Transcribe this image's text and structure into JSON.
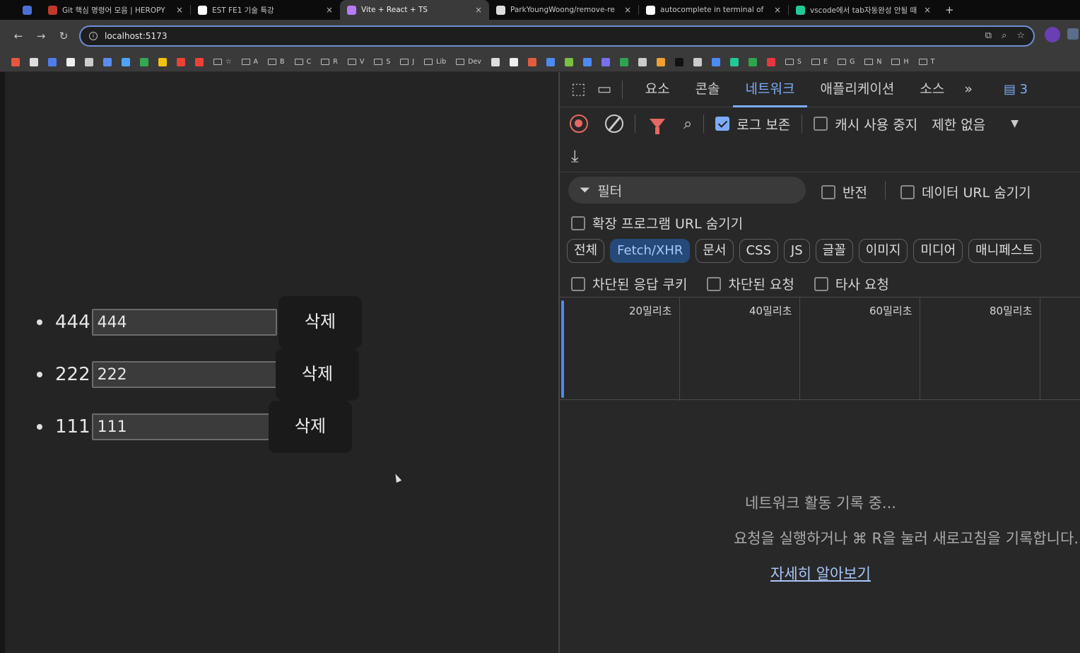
{
  "browser": {
    "tabs": [
      {
        "label": "",
        "color": "#4c6fd6",
        "active": false
      },
      {
        "label": "Git 핵심 명령어 모음 | HEROPY",
        "color": "#c0392b",
        "active": false
      },
      {
        "label": "EST FE1 기술 특강",
        "color": "#ffffff",
        "active": false
      },
      {
        "label": "Vite + React + TS",
        "color": "#b77cf5",
        "active": true
      },
      {
        "label": "ParkYoungWoong/remove-re",
        "color": "#dddddd",
        "active": false
      },
      {
        "label": "autocomplete in terminal of",
        "color": "#ffffff",
        "active": false
      },
      {
        "label": "vscode에서 tab자동완성 안될 때",
        "color": "#20c997",
        "active": false
      }
    ],
    "new_tab": "+",
    "tab_close": "×",
    "url": "localhost:5173",
    "bookmarks": [
      {
        "type": "icon",
        "color": "#e8563f"
      },
      {
        "type": "icon",
        "color": "#dddddd"
      },
      {
        "type": "icon",
        "color": "#4f7df0"
      },
      {
        "type": "icon",
        "color": "#eeeeee"
      },
      {
        "type": "icon",
        "color": "#cccccc"
      },
      {
        "type": "icon",
        "color": "#5b8def"
      },
      {
        "type": "icon",
        "color": "#4fa3f7"
      },
      {
        "type": "icon",
        "color": "#34a853"
      },
      {
        "type": "icon",
        "color": "#f4c20d"
      },
      {
        "type": "icon",
        "color": "#ea4335"
      },
      {
        "type": "icon",
        "color": "#ea4335"
      },
      {
        "type": "folder",
        "label": "☆"
      },
      {
        "type": "folder",
        "label": "A"
      },
      {
        "type": "folder",
        "label": "B"
      },
      {
        "type": "folder",
        "label": "C"
      },
      {
        "type": "folder",
        "label": "R"
      },
      {
        "type": "folder",
        "label": "V"
      },
      {
        "type": "folder",
        "label": "S"
      },
      {
        "type": "folder",
        "label": "J"
      },
      {
        "type": "folder",
        "label": "Lib"
      },
      {
        "type": "folder",
        "label": "Dev"
      },
      {
        "type": "icon",
        "color": "#dddddd"
      },
      {
        "type": "icon",
        "color": "#eeeeee"
      },
      {
        "type": "icon",
        "color": "#e25c3c"
      },
      {
        "type": "icon",
        "color": "#4c8bf5"
      },
      {
        "type": "icon",
        "color": "#7ac043"
      },
      {
        "type": "icon",
        "color": "#4c8bf5"
      },
      {
        "type": "icon",
        "color": "#7a6ff0"
      },
      {
        "type": "icon",
        "color": "#2ea44f"
      },
      {
        "type": "icon",
        "color": "#cccccc"
      },
      {
        "type": "icon",
        "color": "#f0a030"
      },
      {
        "type": "icon",
        "color": "#111111"
      },
      {
        "type": "icon",
        "color": "#cccccc"
      },
      {
        "type": "icon",
        "color": "#4c8bf5"
      },
      {
        "type": "icon",
        "color": "#20c997"
      },
      {
        "type": "icon",
        "color": "#2ea44f"
      },
      {
        "type": "icon",
        "color": "#e8363f"
      },
      {
        "type": "folder",
        "label": "S"
      },
      {
        "type": "folder",
        "label": "E"
      },
      {
        "type": "folder",
        "label": "G"
      },
      {
        "type": "folder",
        "label": "N"
      },
      {
        "type": "folder",
        "label": "H"
      },
      {
        "type": "folder",
        "label": "T"
      }
    ]
  },
  "app": {
    "items": [
      {
        "label": "444",
        "value": "444",
        "delete_label": "삭제"
      },
      {
        "label": "222",
        "value": "222",
        "delete_label": "삭제"
      },
      {
        "label": "111",
        "value": "111",
        "delete_label": "삭제"
      }
    ]
  },
  "devtools": {
    "tabs": [
      "요소",
      "콘솔",
      "네트워크",
      "애플리케이션",
      "소스"
    ],
    "active_tab": "네트워크",
    "more_tabs": "»",
    "issues_count": "3",
    "toolbar": {
      "preserve_log": "로그 보존",
      "preserve_log_checked": true,
      "disable_cache": "캐시 사용 중지",
      "disable_cache_checked": false,
      "throttle": "제한 없음"
    },
    "filter": {
      "placeholder": "필터",
      "invert": "반전",
      "hide_data_urls": "데이터 URL 숨기기",
      "hide_extension_urls": "확장 프로그램 URL 숨기기"
    },
    "type_chips": [
      "전체",
      "Fetch/XHR",
      "문서",
      "CSS",
      "JS",
      "글꼴",
      "이미지",
      "미디어",
      "매니페스트"
    ],
    "active_chip": "Fetch/XHR",
    "blocked": {
      "blocked_cookies": "차단된 응답 쿠키",
      "blocked_requests": "차단된 요청",
      "third_party": "타사 요청"
    },
    "timeline_ticks": [
      "20밀리초",
      "40밀리초",
      "60밀리초",
      "80밀리초"
    ],
    "empty_state": {
      "recording": "네트워크 활동 기록 중...",
      "hint": "요청을 실행하거나 ⌘ R을 눌러 새로고침을 기록합니다.",
      "learn_more": "자세히 알아보기"
    }
  }
}
